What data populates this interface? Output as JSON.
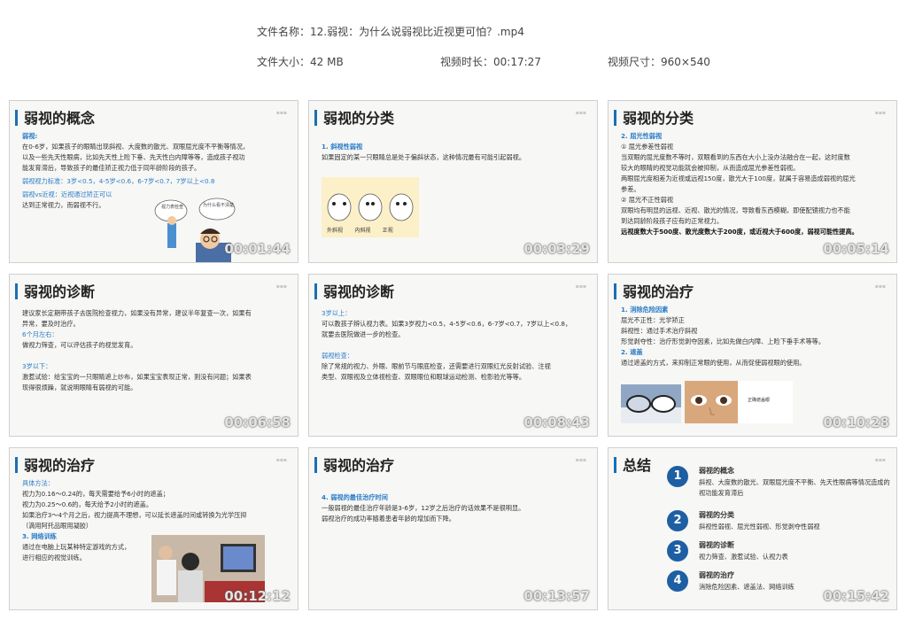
{
  "file_info": {
    "name_label": "文件名称：",
    "name_value": "12.弱视：为什么说弱视比近视更可怕？.mp4",
    "size_label": "文件大小：",
    "size_value": "42 MB",
    "duration_label": "视频时长：",
    "duration_value": "00:17:27",
    "dims_label": "视频尺寸：",
    "dims_value": "960×540"
  },
  "thumbs": [
    {
      "title": "弱视的概念",
      "timestamp": "00:01:44",
      "lines": [
        "弱视:",
        "在0-6岁，如果孩子的眼睛出现斜视、大度数的散光、双眼屈光度不平衡等情况，",
        "以及一些先天性眼病，比如先天性上睑下垂、先天性白内障等等，造成孩子视功",
        "能发育滞后，导致孩子的最佳矫正视力低于同年龄阶段的孩子。",
        "弱视视力标准：3岁<0.5，4-5岁<0.6，6-7岁<0.7，7岁以上<0.8",
        "弱视vs近视：近视通过矫正可以",
        "达到正常视力，而弱视不行。"
      ],
      "bubbles": [
        "视力表检查",
        "为什么看不清楚"
      ]
    },
    {
      "title": "弱视的分类",
      "timestamp": "00:03:29",
      "lines": [
        "1. 斜视性弱视",
        "如果固定的某一只眼睛总是处于偏斜状态，这种情况最有可能引起弱视。"
      ],
      "labels": [
        "外斜视",
        "内斜视",
        "正视"
      ]
    },
    {
      "title": "弱视的分类",
      "timestamp": "00:05:14",
      "lines": [
        "2. 屈光性弱视",
        "① 屈光参差性弱视",
        "当双眼的屈光度数不等时，双眼看到的东西在大小上没办法融合在一起，这时度数",
        "较大的眼睛的视觉功能就会被抑制，从而造成屈光参差性弱视。",
        "两眼屈光度相差为近视或远视150度，散光大于100度，就属于容易造成弱视的屈光",
        "参差。",
        "② 屈光不正性弱视",
        "双眼均有明显的远视、近视、散光的情况，导致看东西模糊，即使配镜视力也不能",
        "到达同龄阶段孩子应有的正常视力。",
        "远视度数大于500度、散光度数大于200度，或近视大于600度，弱视可能性提高。"
      ]
    },
    {
      "title": "弱视的诊断",
      "timestamp": "00:06:58",
      "lines": [
        "建议家长定期带孩子去医院检查视力，如果没有异常，建议半年复查一次，如果有",
        "异常，要及时治疗。",
        "6个月左右：",
        "做视力筛查，可以评估孩子的视觉发育。",
        "",
        "3岁以下：",
        "激惹试验：给宝宝的一只眼睛遮上纱布，如果宝宝表现正常，则没有问题；如果表",
        "现得很烦躁，就说明眼睛有弱视的可能。"
      ]
    },
    {
      "title": "弱视的诊断",
      "timestamp": "00:08:43",
      "lines": [
        "3岁以上：",
        "可以教孩子辨认视力表。如果3岁视力<0.5，4-5岁<0.6，6-7岁<0.7，7岁以上<0.8，",
        "就要去医院做进一步的检查。",
        "",
        "弱视检查：",
        "除了常规的视力、外眼、眼前节与眼底检查，还需要进行双眼红光反射试验、注视",
        "类型、双眼视及立体视检查、双眼眼位和眼球运动检测、检影验光等等。"
      ]
    },
    {
      "title": "弱视的治疗",
      "timestamp": "00:10:28",
      "lines": [
        "1. 消除危险因素",
        "屈光不正性：光学矫正",
        "斜视性：通过手术治疗斜视",
        "形觉剥夺性：治疗形觉剥夺因素，比如先做白内障、上睑下垂手术等等。",
        "2. 遮盖",
        "通过遮盖的方式，来抑制正常眼的使用，从而促使弱视眼的使用。"
      ],
      "photo_label": "正确遮盖眼"
    },
    {
      "title": "弱视的治疗",
      "timestamp": "00:12:12",
      "lines": [
        "具体方法：",
        "视力为0.16～0.24的，每天需要给予6小时的遮盖；",
        "视力为0.25～0.6的，每天给予2小时的遮盖。",
        "如果治疗3～4个月之后，视力提高不理想，可以延长遮盖时间或转换为光学压抑",
        "（滴用阿托品眼用凝胶）",
        "3. 网络训练",
        "通过在电脑上玩某种特定游戏的方式，",
        "进行相应的视觉训练。"
      ]
    },
    {
      "title": "弱视的治疗",
      "timestamp": "00:13:57",
      "lines": [
        "4. 弱视的最佳治疗时间",
        "一般弱视的最佳治疗年龄是3-6岁，12岁之后治疗的话效果不是很明显。",
        "弱视治疗的成功率随着患者年龄的增加而下降。"
      ]
    },
    {
      "title": "总结",
      "timestamp": "00:15:42",
      "items": [
        {
          "num": "1",
          "head": "弱视的概念",
          "desc": "斜视、大度数的散光、双眼屈光度不平衡、先天性眼病等情况造成的视功能发育滞后"
        },
        {
          "num": "2",
          "head": "弱视的分类",
          "desc": "斜视性弱视、屈光性弱视、形觉剥夺性弱视"
        },
        {
          "num": "3",
          "head": "弱视的诊断",
          "desc": "视力筛查、激惹试验、认视力表"
        },
        {
          "num": "4",
          "head": "弱视的治疗",
          "desc": "消除危险因素、遮盖法、网络训练"
        }
      ]
    }
  ],
  "colors": {
    "accent": "#2a7cc7",
    "number_circle": "#1e5fa3",
    "title_bar": "#1a6fb5"
  }
}
